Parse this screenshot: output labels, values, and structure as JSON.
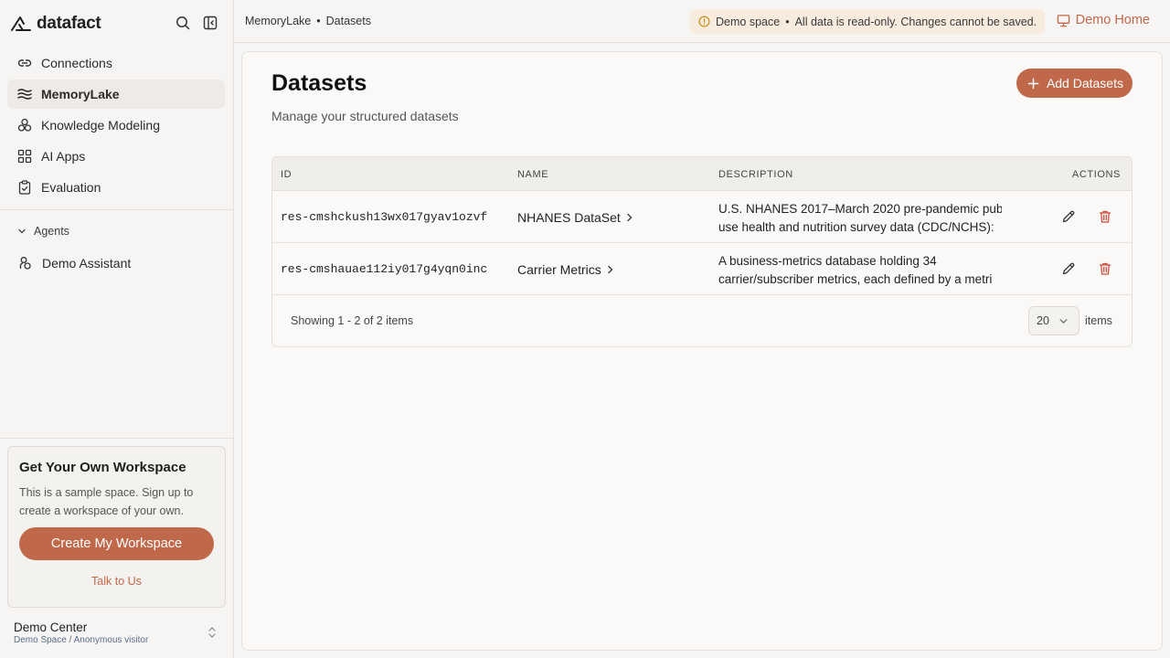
{
  "app": {
    "name": "datafact"
  },
  "sidebar": {
    "items": [
      {
        "label": "Connections",
        "icon": "link-icon"
      },
      {
        "label": "MemoryLake",
        "icon": "waves-icon"
      },
      {
        "label": "Knowledge Modeling",
        "icon": "cubes-icon"
      },
      {
        "label": "AI Apps",
        "icon": "grid-icon"
      },
      {
        "label": "Evaluation",
        "icon": "clipboard-check-icon"
      }
    ],
    "agents_label": "Agents",
    "agent_item": "Demo Assistant",
    "promo": {
      "title": "Get Your Own Workspace",
      "text": "This is a sample space. Sign up to create a workspace of your own.",
      "button": "Create My Workspace",
      "link": "Talk to Us"
    },
    "account": {
      "name": "Demo Center",
      "sub": "Demo Space / Anonymous visitor"
    }
  },
  "topbar": {
    "breadcrumb": [
      "MemoryLake",
      "•",
      "Datasets"
    ],
    "banner": {
      "title": "Demo space",
      "sep": "•",
      "text": "All data is read-only. Changes cannot be saved."
    },
    "demo_home": "Demo Home"
  },
  "main": {
    "title": "Datasets",
    "subtitle": "Manage your structured datasets",
    "add_button": "Add Datasets",
    "table": {
      "headers": [
        "ID",
        "NAME",
        "DESCRIPTION",
        "ACTIONS"
      ],
      "rows": [
        {
          "id": "res-cmshckush13wx017gyav1ozvf",
          "name": "NHANES DataSet",
          "desc1": "U.S. NHANES 2017–March 2020 pre-pandemic pub",
          "desc2": "use health and nutrition survey data (CDC/NCHS):"
        },
        {
          "id": "res-cmshauae112iy017g4yqn0inc",
          "name": "Carrier Metrics",
          "desc1": "A business-metrics database holding 34",
          "desc2": "carrier/subscriber metrics, each defined by a metri"
        }
      ],
      "showing": "Showing 1 - 2 of 2 items",
      "page_size": "20",
      "items_label": "items"
    }
  },
  "colors": {
    "accent": "#c0684a",
    "banner_bg": "#f7ecdd",
    "danger": "#d04a3a"
  }
}
